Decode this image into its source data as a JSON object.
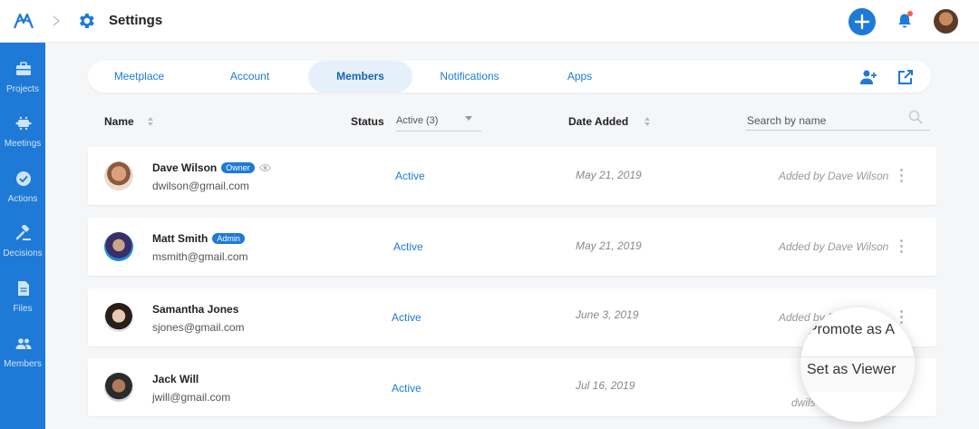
{
  "header": {
    "title": "Settings",
    "accent": "#1e7ad6"
  },
  "sidebar": {
    "items": [
      {
        "label": "Projects",
        "icon": "briefcase-icon"
      },
      {
        "label": "Meetings",
        "icon": "meetings-icon"
      },
      {
        "label": "Actions",
        "icon": "check-circle-icon"
      },
      {
        "label": "Decisions",
        "icon": "gavel-icon"
      },
      {
        "label": "Files",
        "icon": "file-icon"
      },
      {
        "label": "Members",
        "icon": "people-icon"
      }
    ]
  },
  "tabs": [
    {
      "label": "Meetplace",
      "active": false
    },
    {
      "label": "Account",
      "active": false
    },
    {
      "label": "Members",
      "active": true
    },
    {
      "label": "Notifications",
      "active": false
    },
    {
      "label": "Apps",
      "active": false
    }
  ],
  "table": {
    "headers": {
      "name": "Name",
      "status": "Status",
      "date": "Date Added"
    },
    "status_filter": "Active (3)",
    "search_placeholder": "Search by name",
    "rows": [
      {
        "name": "Dave Wilson",
        "badge": "Owner",
        "email": "dwilson@gmail.com",
        "status": "Active",
        "date": "May 21, 2019",
        "added_by": "Added by Dave Wilson"
      },
      {
        "name": "Matt Smith",
        "badge": "Admin",
        "email": "msmith@gmail.com",
        "status": "Active",
        "date": "May 21, 2019",
        "added_by": "Added by Dave Wilson"
      },
      {
        "name": "Samantha Jones",
        "badge": "",
        "email": "sjones@gmail.com",
        "status": "Active",
        "date": "June 3, 2019",
        "added_by": "Added by D"
      },
      {
        "name": "Jack Will",
        "badge": "",
        "email": "jwill@gmail.com",
        "status": "Active",
        "date": "Jul 16, 2019",
        "added_by": "dwils"
      }
    ]
  },
  "context_menu": {
    "items": [
      "Promote as A",
      "Set as Viewer"
    ]
  }
}
